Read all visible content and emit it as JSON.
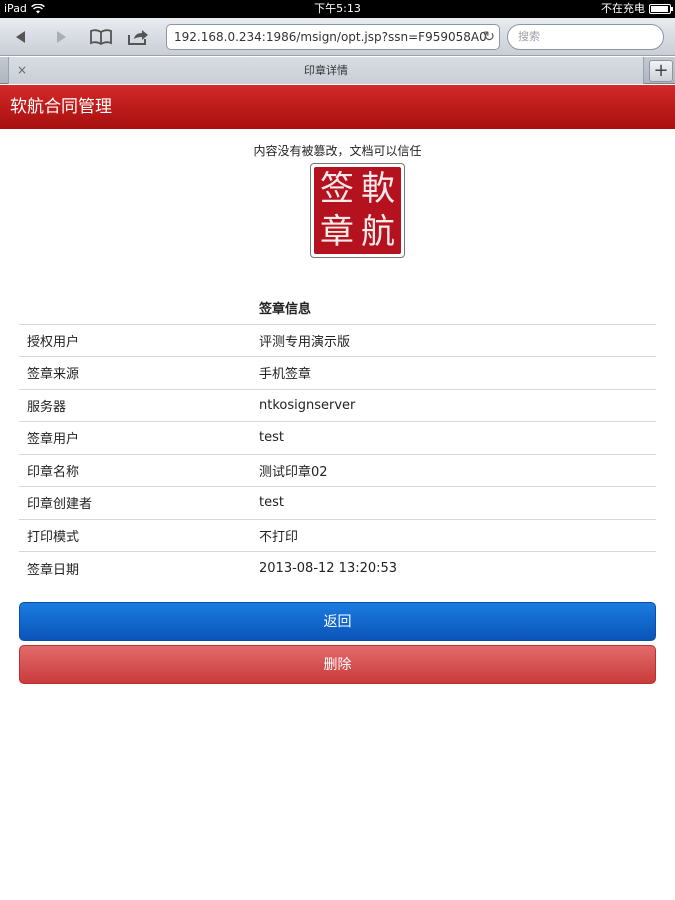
{
  "status_bar": {
    "device": "iPad",
    "time": "下午5:13",
    "charging_text": "不在充电"
  },
  "browser": {
    "url": "192.168.0.234:1986/msign/opt.jsp?ssn=F959058A0",
    "search_placeholder": "搜索",
    "tab_title": "印章详情",
    "tab_close": "×",
    "tab_add": "+"
  },
  "app": {
    "title": "软航合同管理"
  },
  "content": {
    "verify_message": "内容没有被篡改，文档可以信任",
    "seal_chars": [
      "軟",
      "航",
      "签",
      "章"
    ],
    "table_header": "签章信息",
    "rows": [
      {
        "key": "授权用户",
        "value": "评测专用演示版"
      },
      {
        "key": "签章来源",
        "value": "手机签章"
      },
      {
        "key": "服务器",
        "value": "ntkosignserver"
      },
      {
        "key": "签章用户",
        "value": "test"
      },
      {
        "key": "印章名称",
        "value": "测试印章02"
      },
      {
        "key": "印章创建者",
        "value": "test"
      },
      {
        "key": "打印模式",
        "value": "不打印"
      },
      {
        "key": "签章日期",
        "value": "2013-08-12 13:20:53"
      }
    ],
    "back_button": "返回",
    "delete_button": "删除"
  },
  "colors": {
    "header_red": "#c21a1a",
    "seal_red": "#b3121e",
    "back_blue": "#1466cc",
    "delete_red": "#d45050"
  }
}
